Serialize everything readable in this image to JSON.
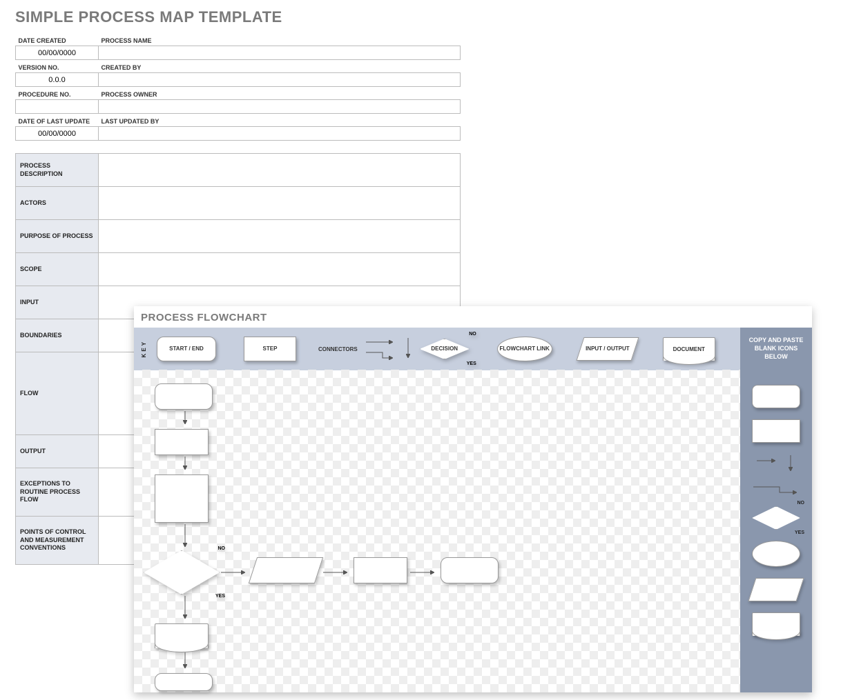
{
  "title": "SIMPLE PROCESS MAP TEMPLATE",
  "header_fields": {
    "date_created": {
      "label": "DATE CREATED",
      "value": "00/00/0000"
    },
    "process_name": {
      "label": "PROCESS NAME",
      "value": ""
    },
    "version_no": {
      "label": "VERSION NO.",
      "value": "0.0.0"
    },
    "created_by": {
      "label": "CREATED BY",
      "value": ""
    },
    "procedure_no": {
      "label": "PROCEDURE NO.",
      "value": ""
    },
    "process_owner": {
      "label": "PROCESS OWNER",
      "value": ""
    },
    "date_last_update": {
      "label": "DATE OF LAST UPDATE",
      "value": "00/00/0000"
    },
    "last_updated_by": {
      "label": "LAST UPDATED BY",
      "value": ""
    }
  },
  "desc_rows": {
    "process_description": "PROCESS DESCRIPTION",
    "actors": "ACTORS",
    "purpose_of_process": "PURPOSE OF PROCESS",
    "scope": "SCOPE",
    "input": "INPUT",
    "boundaries": "BOUNDARIES",
    "flow": "FLOW",
    "output": "OUTPUT",
    "exceptions": "EXCEPTIONS TO ROUTINE PROCESS FLOW",
    "points_control": "POINTS OF CONTROL AND MEASUREMENT CONVENTIONS"
  },
  "flowchart": {
    "title": "PROCESS FLOWCHART",
    "key_label": "KEY",
    "legend": {
      "start_end": "START / END",
      "step": "STEP",
      "connectors": "CONNECTORS",
      "decision": "DECISION",
      "decision_no": "NO",
      "decision_yes": "YES",
      "flowchart_link": "FLOWCHART LINK",
      "input_output": "INPUT / OUTPUT",
      "document": "DOCUMENT"
    },
    "paste_header": "COPY AND PASTE BLANK ICONS BELOW",
    "palette_decision_no": "NO",
    "palette_decision_yes": "YES",
    "canvas_decision_no": "NO",
    "canvas_decision_yes": "YES"
  }
}
